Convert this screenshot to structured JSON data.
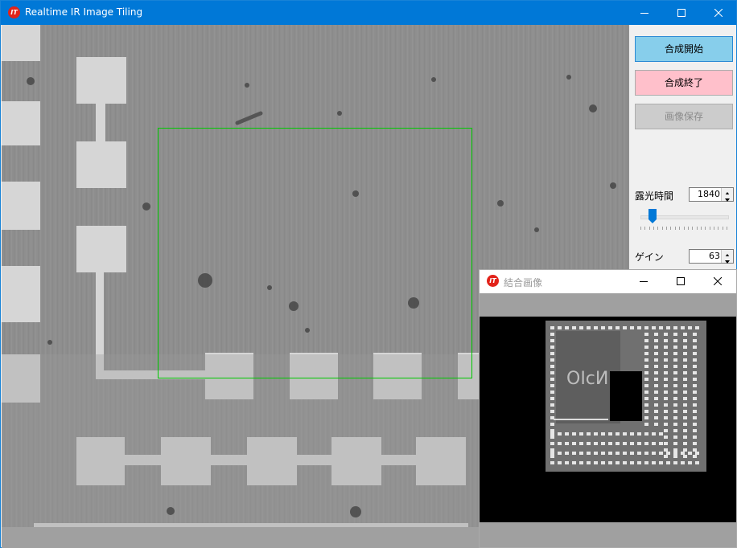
{
  "main_window": {
    "title": "Realtime IR Image Tiling",
    "icon_text": "IT",
    "icons": {
      "app": "app-logo-icon",
      "minimize": "minimize-icon",
      "maximize": "maximize-icon",
      "close": "close-icon"
    },
    "title_bar_color": "#0078d7"
  },
  "controls": {
    "start_button": "合成開始",
    "end_button": "合成終了",
    "save_button": "画像保存",
    "exposure_label": "露光時間",
    "exposure_value": "1840",
    "exposure_slider_position": 0.15,
    "gain_label": "ゲイン",
    "gain_value": "63",
    "colors": {
      "start": "#87ceeb",
      "end": "#ffc0cb",
      "save_disabled": "#cccccc"
    }
  },
  "camera_view": {
    "roi_color": "#00c800"
  },
  "sub_window": {
    "title": "結合画像",
    "icon_text": "IT",
    "chip_marking": "OIсИ"
  }
}
